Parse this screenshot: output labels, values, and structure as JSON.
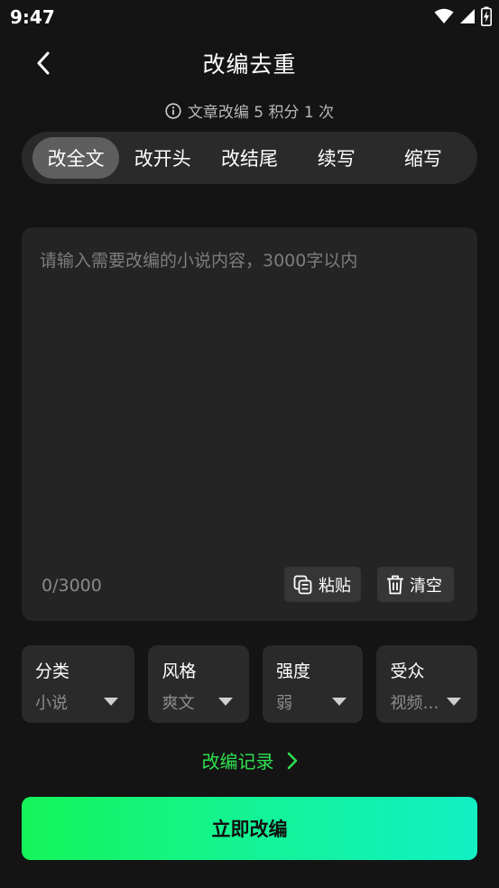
{
  "status": {
    "time": "9:47"
  },
  "header": {
    "title": "改编去重"
  },
  "cost_note": "文章改编 5 积分 1 次",
  "tabs": [
    {
      "label": "改全文",
      "active": true
    },
    {
      "label": "改开头",
      "active": false
    },
    {
      "label": "改结尾",
      "active": false
    },
    {
      "label": "续写",
      "active": false
    },
    {
      "label": "缩写",
      "active": false
    }
  ],
  "editor": {
    "value": "",
    "placeholder": "请输入需要改编的小说内容，3000字以内",
    "count": "0/3000",
    "paste_label": "粘贴",
    "clear_label": "清空"
  },
  "selectors": [
    {
      "label": "分类",
      "value": "小说"
    },
    {
      "label": "风格",
      "value": "爽文"
    },
    {
      "label": "强度",
      "value": "弱"
    },
    {
      "label": "受众",
      "value": "视频…"
    }
  ],
  "history_label": "改编记录",
  "submit_label": "立即改编",
  "colors": {
    "accent": "#2ee04f",
    "bg": "#141414",
    "panel": "#2a2a2a"
  }
}
